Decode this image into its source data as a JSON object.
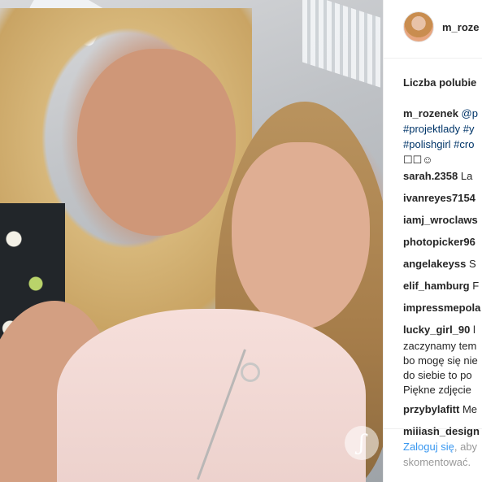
{
  "post": {
    "username": "m_roze",
    "likes_label": "Liczba polubie",
    "caption": {
      "line1_user": "m_rozenek",
      "line1_mention": "@p",
      "line2": "#projektlady #y",
      "line3": "#polishgirl #cro",
      "line4": "☐☐☺"
    },
    "comments": [
      {
        "user": "sarah.2358",
        "text": "La"
      },
      {
        "user": "ivanreyes7154",
        "text": ""
      },
      {
        "user": "iamj_wroclaws",
        "text": ""
      },
      {
        "user": "photopicker96",
        "text": ""
      },
      {
        "user": "angelakeyss",
        "text": "S"
      },
      {
        "user": "elif_hamburg",
        "text": "F"
      },
      {
        "user": "impressmepola",
        "text": ""
      },
      {
        "user": "lucky_girl_90",
        "text": "l"
      }
    ],
    "multiline_comment": [
      "zaczynamy tem",
      "bo mogę się nie",
      "do siebie to po",
      "Piękne zdjęcie"
    ],
    "comments_after": [
      {
        "user": "przybylafitt",
        "text": "Me"
      },
      {
        "user": "millash_design",
        "text": ""
      }
    ],
    "footer": {
      "login": "Zaloguj się",
      "rest_line1": ", aby",
      "line2": "skomentować."
    }
  },
  "photo": {
    "watermark_icon": "logo-icon"
  },
  "colors": {
    "link": "#003569",
    "login": "#3897f0",
    "muted": "#999999",
    "text": "#262626"
  }
}
